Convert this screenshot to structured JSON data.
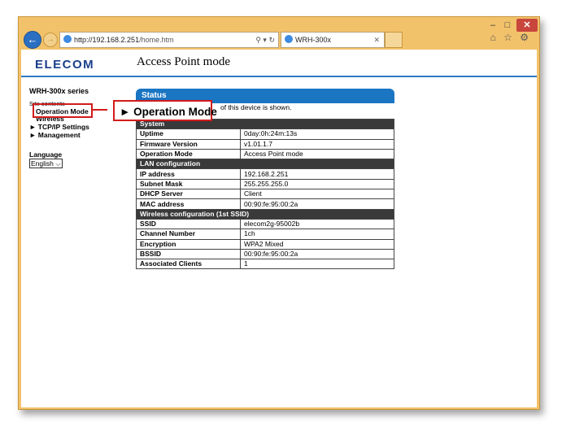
{
  "browser": {
    "window_controls": {
      "minimize": "–",
      "maximize": "□",
      "close": "✕"
    },
    "address_host": "http://192.168.2.251",
    "address_path": "/home.htm",
    "address_tools": "⚲ ▾ ↻",
    "tab_title": "WRH-300x",
    "tab_close": "✕",
    "right_icons": "⌂ ☆ ⚙"
  },
  "page": {
    "logo": "ELECOM",
    "title": "Access Point mode"
  },
  "sidebar": {
    "series": "WRH-300x series",
    "site_contents": "Site contents",
    "items": [
      {
        "label": "Operation Mode"
      },
      {
        "label": "Wireless"
      },
      {
        "label": "► TCP/IP Settings"
      },
      {
        "label": "► Management"
      }
    ],
    "language_label": "Language",
    "language_value": "English"
  },
  "callout": {
    "label": "► Operation Mode"
  },
  "status": {
    "header": "Status",
    "description": "of this device is shown.",
    "rows": [
      {
        "type": "section",
        "label": "System"
      },
      {
        "type": "item",
        "key": "Uptime",
        "value": "0day:0h:24m:13s"
      },
      {
        "type": "item",
        "key": "Firmware Version",
        "value": "v1.01.1.7"
      },
      {
        "type": "item",
        "key": "Operation Mode",
        "value": "Access Point mode"
      },
      {
        "type": "section",
        "label": "LAN configuration"
      },
      {
        "type": "item",
        "key": "IP address",
        "value": "192.168.2.251"
      },
      {
        "type": "item",
        "key": "Subnet Mask",
        "value": "255.255.255.0"
      },
      {
        "type": "item",
        "key": "DHCP Server",
        "value": "Client"
      },
      {
        "type": "item",
        "key": "MAC address",
        "value": "00:90:fe:95:00:2a"
      },
      {
        "type": "section",
        "label": "Wireless configuration (1st SSID)"
      },
      {
        "type": "item",
        "key": "SSID",
        "value": "elecom2g-95002b"
      },
      {
        "type": "item",
        "key": "Channel Number",
        "value": "1ch"
      },
      {
        "type": "item",
        "key": "Encryption",
        "value": "WPA2 Mixed"
      },
      {
        "type": "item",
        "key": "BSSID",
        "value": "00:90:fe:95:00:2a"
      },
      {
        "type": "item",
        "key": "Associated Clients",
        "value": "1"
      }
    ]
  },
  "colors": {
    "accent": "#1a75c3",
    "highlight": "#d21b1b",
    "window_frame": "#f2c26b",
    "section_header": "#3a3a3a"
  }
}
